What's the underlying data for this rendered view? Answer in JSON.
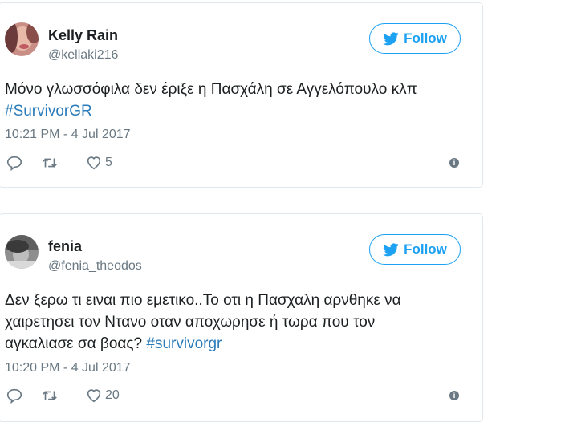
{
  "tweets": [
    {
      "name": "Kelly Rain",
      "handle": "@kellaki216",
      "follow_label": "Follow",
      "text": "Μόνο γλωσσόφιλα δεν έριξε η Πασχάλη σε Αγγελόπουλο κλπ",
      "hashtag": "#SurvivorGR",
      "time": "10:21 PM - 4 Jul 2017",
      "likes": "5"
    },
    {
      "name": "fenia",
      "handle": "@fenia_theodos",
      "follow_label": "Follow",
      "text": "Δεν ξερω τι ειναι πιο εμετικο..Το οτι η Πασχαλη αρνθηκε να χαιρετησει τον Ντανο οταν αποχωρησε ή τωρα που τον αγκαλιασε σα βοας?",
      "hashtag": "#survivorgr",
      "time": "10:20 PM - 4 Jul 2017",
      "likes": "20"
    }
  ],
  "colors": {
    "accent": "#1da1f2",
    "link": "#2b7bb9",
    "muted": "#697882",
    "border": "#e1e8ed"
  },
  "icons": [
    "reply-icon",
    "retweet-icon",
    "heart-icon",
    "info-icon",
    "twitter-bird-icon"
  ]
}
